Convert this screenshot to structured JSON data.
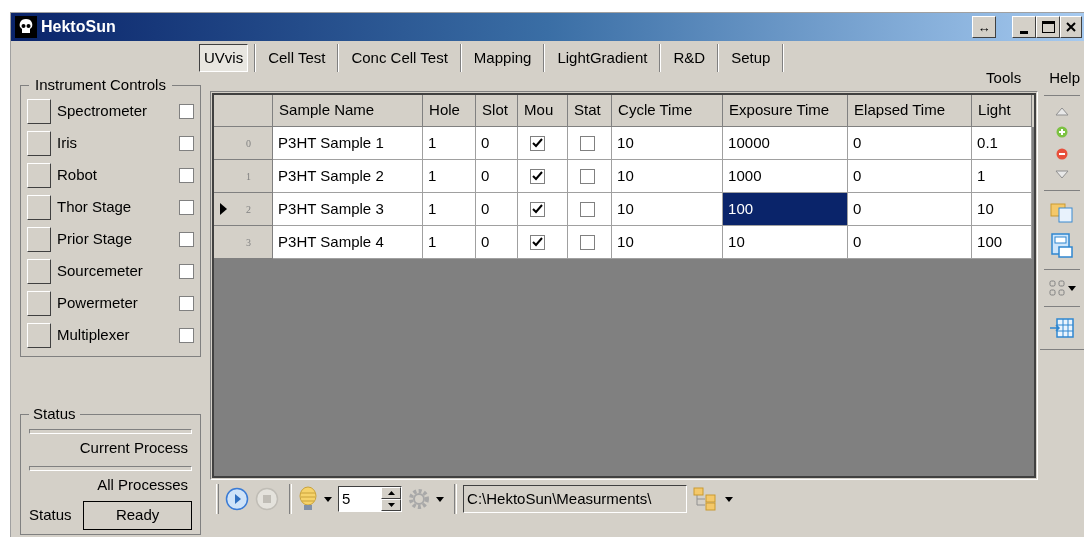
{
  "window": {
    "title": "HektoSun",
    "resize_glyph": "↔"
  },
  "tabs": [
    {
      "label": "UVvis",
      "selected": true
    },
    {
      "label": "Cell Test",
      "selected": false
    },
    {
      "label": "Conc Cell Test",
      "selected": false
    },
    {
      "label": "Mapping",
      "selected": false
    },
    {
      "label": "LightGradient",
      "selected": false
    },
    {
      "label": "R&D",
      "selected": false
    },
    {
      "label": "Setup",
      "selected": false
    }
  ],
  "menu": [
    "Tools",
    "Help"
  ],
  "instrument_controls": {
    "title": "Instrument Controls",
    "items": [
      {
        "label": "Spectrometer",
        "checked": false
      },
      {
        "label": "Iris",
        "checked": false
      },
      {
        "label": "Robot",
        "checked": false
      },
      {
        "label": "Thor Stage",
        "checked": false
      },
      {
        "label": "Prior Stage",
        "checked": false
      },
      {
        "label": "Sourcemeter",
        "checked": false
      },
      {
        "label": "Powermeter",
        "checked": false
      },
      {
        "label": "Multiplexer",
        "checked": false
      }
    ]
  },
  "status": {
    "title": "Status",
    "progress": [
      {
        "label": "Current Process",
        "level": 0
      },
      {
        "label": "All Processes",
        "level": 0
      }
    ],
    "status_label": "Status",
    "status_value": "Ready"
  },
  "table": {
    "columns": [
      "Sample Name",
      "Hole",
      "Slot",
      "Mou",
      "Stat",
      "Cycle Time",
      "Exposure Time",
      "Elapsed Time",
      "Light"
    ],
    "rows": [
      {
        "index": "0",
        "current": false,
        "cells": [
          {
            "kind": "text",
            "text": "P3HT Sample 1",
            "selected": false
          },
          {
            "kind": "text",
            "text": "1",
            "selected": false
          },
          {
            "kind": "text",
            "text": "0",
            "selected": false
          },
          {
            "kind": "check",
            "checked": true,
            "selected": false
          },
          {
            "kind": "check",
            "checked": false,
            "selected": false
          },
          {
            "kind": "text",
            "text": "10",
            "selected": false
          },
          {
            "kind": "text",
            "text": "10000",
            "selected": false
          },
          {
            "kind": "text",
            "text": "0",
            "selected": false
          },
          {
            "kind": "text",
            "text": "0.1",
            "selected": false
          }
        ]
      },
      {
        "index": "1",
        "current": false,
        "cells": [
          {
            "kind": "text",
            "text": "P3HT Sample 2",
            "selected": false
          },
          {
            "kind": "text",
            "text": "1",
            "selected": false
          },
          {
            "kind": "text",
            "text": "0",
            "selected": false
          },
          {
            "kind": "check",
            "checked": true,
            "selected": false
          },
          {
            "kind": "check",
            "checked": false,
            "selected": false
          },
          {
            "kind": "text",
            "text": "10",
            "selected": false
          },
          {
            "kind": "text",
            "text": "1000",
            "selected": false
          },
          {
            "kind": "text",
            "text": "0",
            "selected": false
          },
          {
            "kind": "text",
            "text": "1",
            "selected": false
          }
        ]
      },
      {
        "index": "2",
        "current": true,
        "cells": [
          {
            "kind": "text",
            "text": "P3HT Sample 3",
            "selected": false
          },
          {
            "kind": "text",
            "text": "1",
            "selected": false
          },
          {
            "kind": "text",
            "text": "0",
            "selected": false
          },
          {
            "kind": "check",
            "checked": true,
            "selected": false
          },
          {
            "kind": "check",
            "checked": false,
            "selected": false
          },
          {
            "kind": "text",
            "text": "10",
            "selected": false
          },
          {
            "kind": "text",
            "text": "100",
            "selected": true
          },
          {
            "kind": "text",
            "text": "0",
            "selected": false
          },
          {
            "kind": "text",
            "text": "10",
            "selected": false
          }
        ]
      },
      {
        "index": "3",
        "current": false,
        "cells": [
          {
            "kind": "text",
            "text": "P3HT Sample 4",
            "selected": false
          },
          {
            "kind": "text",
            "text": "1",
            "selected": false
          },
          {
            "kind": "text",
            "text": "0",
            "selected": false
          },
          {
            "kind": "check",
            "checked": true,
            "selected": false
          },
          {
            "kind": "check",
            "checked": false,
            "selected": false
          },
          {
            "kind": "text",
            "text": "10",
            "selected": false
          },
          {
            "kind": "text",
            "text": "10",
            "selected": false
          },
          {
            "kind": "text",
            "text": "0",
            "selected": false
          },
          {
            "kind": "text",
            "text": "100",
            "selected": false
          }
        ]
      }
    ]
  },
  "toolbar": {
    "repeat_count": "5",
    "path": "C:\\HektoSun\\Measurments\\"
  }
}
